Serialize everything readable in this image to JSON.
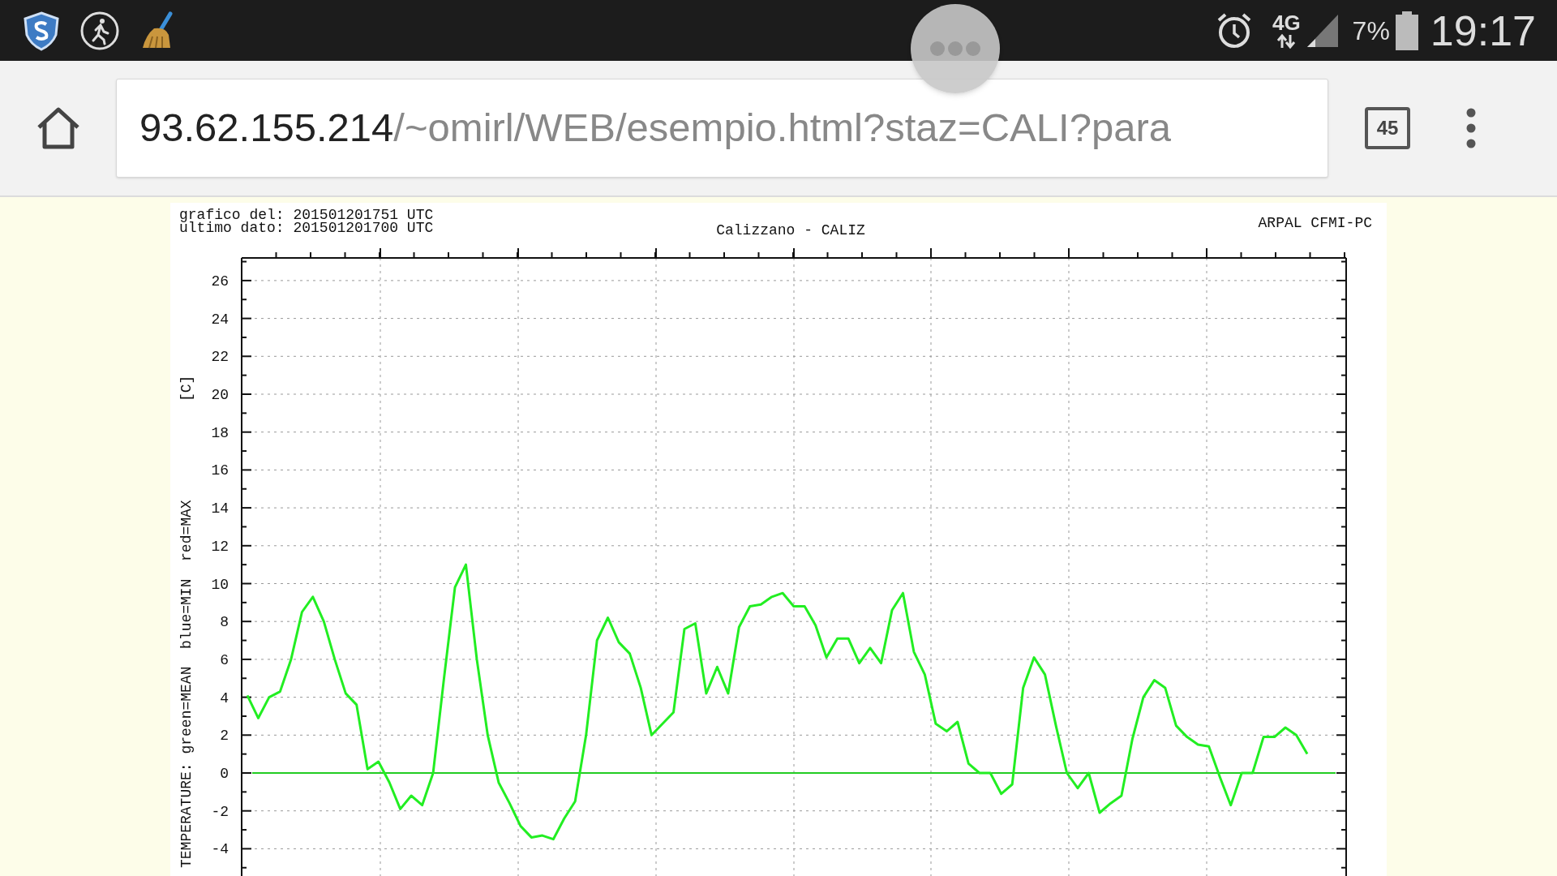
{
  "status_bar": {
    "network": "4G",
    "battery": "7%",
    "time": "19:17"
  },
  "address_bar": {
    "host": "93.62.155.214",
    "path": "/~omirl/WEB/esempio.html?staz=CALI?para",
    "tab_count": "45"
  },
  "chart": {
    "generated": "grafico del: 201501201751 UTC",
    "last_data": "ultimo dato: 201501201700 UTC",
    "source": "ARPAL CFMI-PC",
    "unit_label": "[C]",
    "chart_data": {
      "type": "line",
      "grid": true,
      "ref_lines": [
        {
          "axis": "y",
          "value": 0,
          "color": "#22cc22"
        }
      ],
      "title": "Calizzano - CALIZ",
      "ylabel": "TEMPERATURE: green=MEAN  blue=MIN  red=MAX",
      "ylim": [
        -4,
        26
      ],
      "yticks": [
        -4,
        -2,
        0,
        2,
        4,
        6,
        8,
        10,
        12,
        14,
        16,
        18,
        20,
        22,
        24,
        26
      ],
      "series": [
        {
          "color": "#22ee22",
          "values": [
            4.1,
            2.9,
            4.0,
            4.3,
            6,
            8.5,
            9.3,
            8,
            6,
            4.2,
            3.6,
            0.2,
            0.6,
            -0.5,
            -1.9,
            -1.2,
            -1.7,
            0,
            5,
            9.8,
            11,
            6,
            2,
            -0.5,
            -1.6,
            -2.8,
            -3.4,
            -3.3,
            -3.5,
            -2.4,
            -1.5,
            2,
            7,
            8.2,
            6.9,
            6.3,
            4.5,
            2,
            2.6,
            3.2,
            7.6,
            7.9,
            4.2,
            5.6,
            4.2,
            7.7,
            8.8,
            8.9,
            9.3,
            9.5,
            8.8,
            8.8,
            7.8,
            6.1,
            7.1,
            7.1,
            5.8,
            6.6,
            5.8,
            8.6,
            9.5,
            6.4,
            5.2,
            2.6,
            2.2,
            2.7,
            0.5,
            0,
            0,
            -1.1,
            -0.6,
            4.5,
            6.1,
            5.2,
            2.5,
            0,
            -0.8,
            0,
            -2.1,
            -1.6,
            -1.2,
            1.8,
            4,
            4.9,
            4.5,
            2.5,
            1.9,
            1.5,
            1.4,
            -0.2,
            -1.7,
            0,
            0,
            1.9,
            1.9,
            2.4,
            2.0,
            1.0
          ]
        }
      ]
    }
  }
}
